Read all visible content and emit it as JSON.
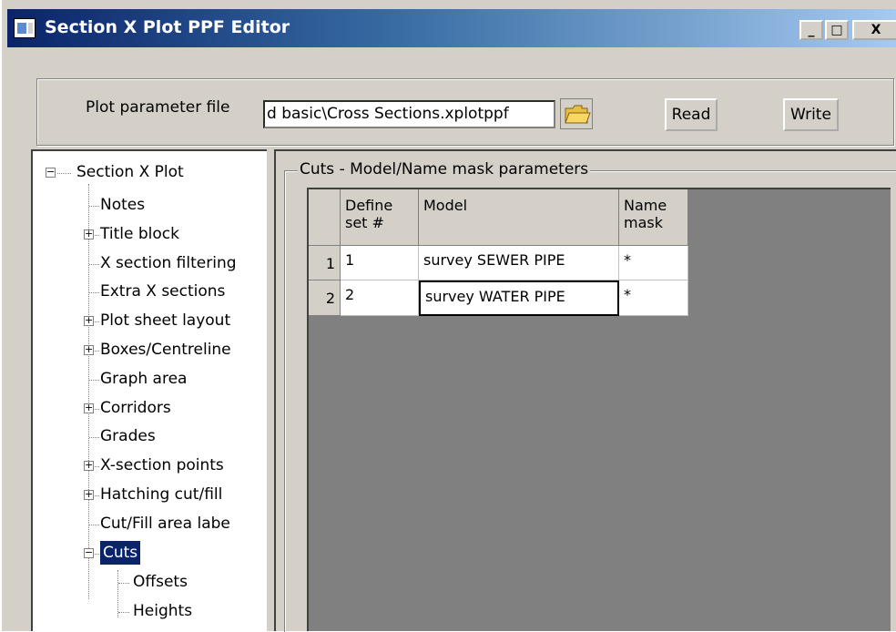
{
  "window": {
    "title": "Section X Plot PPF Editor",
    "minimize_icon": "minimize-icon",
    "maximize_icon": "maximize-icon",
    "close_icon": "close-icon",
    "min_glyph": "_",
    "max_glyph": "□",
    "close_glyph": "X"
  },
  "param_file": {
    "label": "Plot parameter file",
    "value": "d basic\\Cross Sections.xplotppf",
    "browse_icon": "folder-icon",
    "read_label": "Read",
    "write_label": "Write"
  },
  "tree": {
    "root": {
      "label": "Section X Plot",
      "expander": "−"
    },
    "items": [
      {
        "label": "Notes",
        "expander": ""
      },
      {
        "label": "Title block",
        "expander": "+"
      },
      {
        "label": "X section filtering",
        "expander": ""
      },
      {
        "label": "Extra X sections",
        "expander": ""
      },
      {
        "label": "Plot sheet layout",
        "expander": "+"
      },
      {
        "label": "Boxes/Centreline",
        "expander": "+"
      },
      {
        "label": "Graph area",
        "expander": ""
      },
      {
        "label": "Corridors",
        "expander": "+"
      },
      {
        "label": "Grades",
        "expander": ""
      },
      {
        "label": "X-section points",
        "expander": "+"
      },
      {
        "label": "Hatching cut/fill",
        "expander": "+"
      },
      {
        "label": "Cut/Fill area labe",
        "expander": ""
      },
      {
        "label": "Cuts",
        "expander": "−",
        "selected": true
      }
    ],
    "cuts_children": [
      {
        "label": "Offsets"
      },
      {
        "label": "Heights"
      }
    ]
  },
  "cuts_panel": {
    "group_title": "Cuts - Model/Name mask parameters",
    "columns": [
      {
        "line1": "Define",
        "line2": "set #"
      },
      {
        "line1": "Model",
        "line2": ""
      },
      {
        "line1": "Name",
        "line2": "mask"
      }
    ],
    "rows": [
      {
        "row_num": "1",
        "define_set": "1",
        "model": "survey SEWER PIPE",
        "name_mask": "*"
      },
      {
        "row_num": "2",
        "define_set": "2",
        "model": "survey WATER PIPE",
        "name_mask": "*"
      }
    ]
  },
  "colors": {
    "titlebar_start": "#0a246a",
    "titlebar_end": "#a6caf0",
    "face": "#d4d0c8",
    "selection": "#0a246a",
    "grid_background": "#808080"
  }
}
